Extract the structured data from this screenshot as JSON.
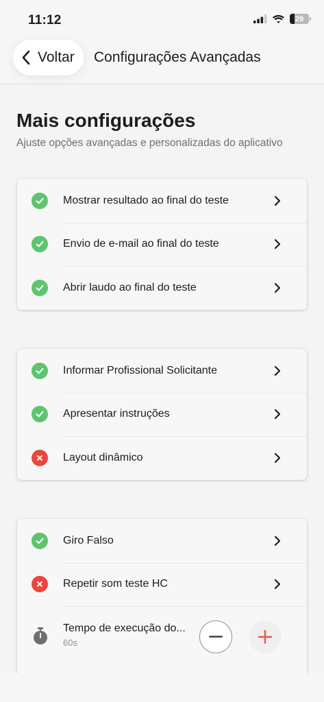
{
  "status_bar": {
    "time": "11:12",
    "battery_level": "29"
  },
  "header": {
    "back_label": "Voltar",
    "title": "Configurações Avançadas"
  },
  "page": {
    "title": "Mais configurações",
    "subtitle": "Ajuste opções avançadas e personalizadas do aplicativo"
  },
  "colors": {
    "enabled": "#5ec46f",
    "disabled": "#e8473f",
    "plus_accent": "#e8574f"
  },
  "group1": {
    "items": [
      {
        "label": "Mostrar resultado ao final do teste",
        "status": "enabled",
        "icon": "check-icon"
      },
      {
        "label": "Envio de e-mail ao final do teste",
        "status": "enabled",
        "icon": "check-icon"
      },
      {
        "label": "Abrir laudo ao final do teste",
        "status": "enabled",
        "icon": "check-icon"
      }
    ]
  },
  "group2": {
    "items": [
      {
        "label": "Informar Profissional Solicitante",
        "status": "enabled",
        "icon": "check-icon"
      },
      {
        "label": "Apresentar instruções",
        "status": "enabled",
        "icon": "check-icon"
      },
      {
        "label": "Layout dinâmico",
        "status": "disabled",
        "icon": "x-icon"
      }
    ]
  },
  "group3": {
    "items": [
      {
        "label": "Giro Falso",
        "status": "enabled",
        "icon": "check-icon"
      },
      {
        "label": "Repetir som teste HC",
        "status": "disabled",
        "icon": "x-icon"
      }
    ],
    "stepper": {
      "label": "Tempo de execução do...",
      "value": "60s",
      "icon": "timer-icon"
    }
  }
}
